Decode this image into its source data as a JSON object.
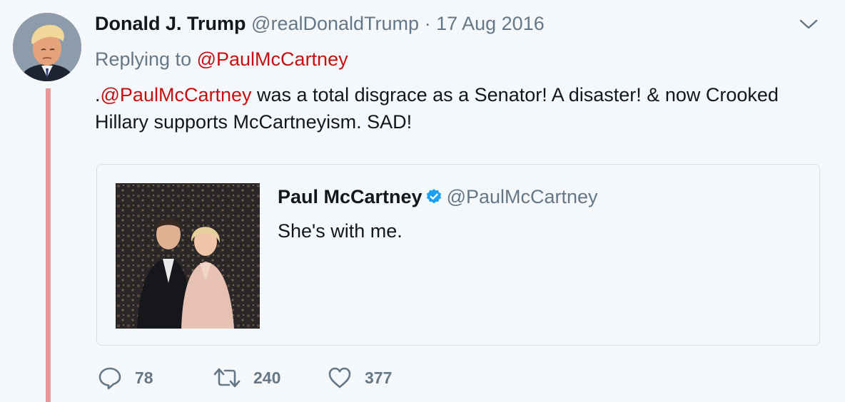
{
  "author": {
    "name": "Donald J. Trump",
    "handle": "@realDonaldTrump",
    "separator": "·",
    "date": "17 Aug 2016"
  },
  "reply": {
    "prefix": "Replying to",
    "to": "@PaulMcCartney"
  },
  "body": {
    "lead": ".",
    "mention": "@PaulMcCartney",
    "text": " was a total disgrace as a Senator! A disaster! & now Crooked Hillary supports McCartneyism. SAD!"
  },
  "quote": {
    "name": "Paul McCartney",
    "verified_icon": "verified-badge-icon",
    "handle": "@PaulMcCartney",
    "text": "She's with me."
  },
  "actions": {
    "replies": "78",
    "retweets": "240",
    "likes": "377"
  },
  "colors": {
    "mention": "#c70f10",
    "thread_line": "#e5999a",
    "muted": "#657786",
    "verified": "#1da1f2"
  }
}
